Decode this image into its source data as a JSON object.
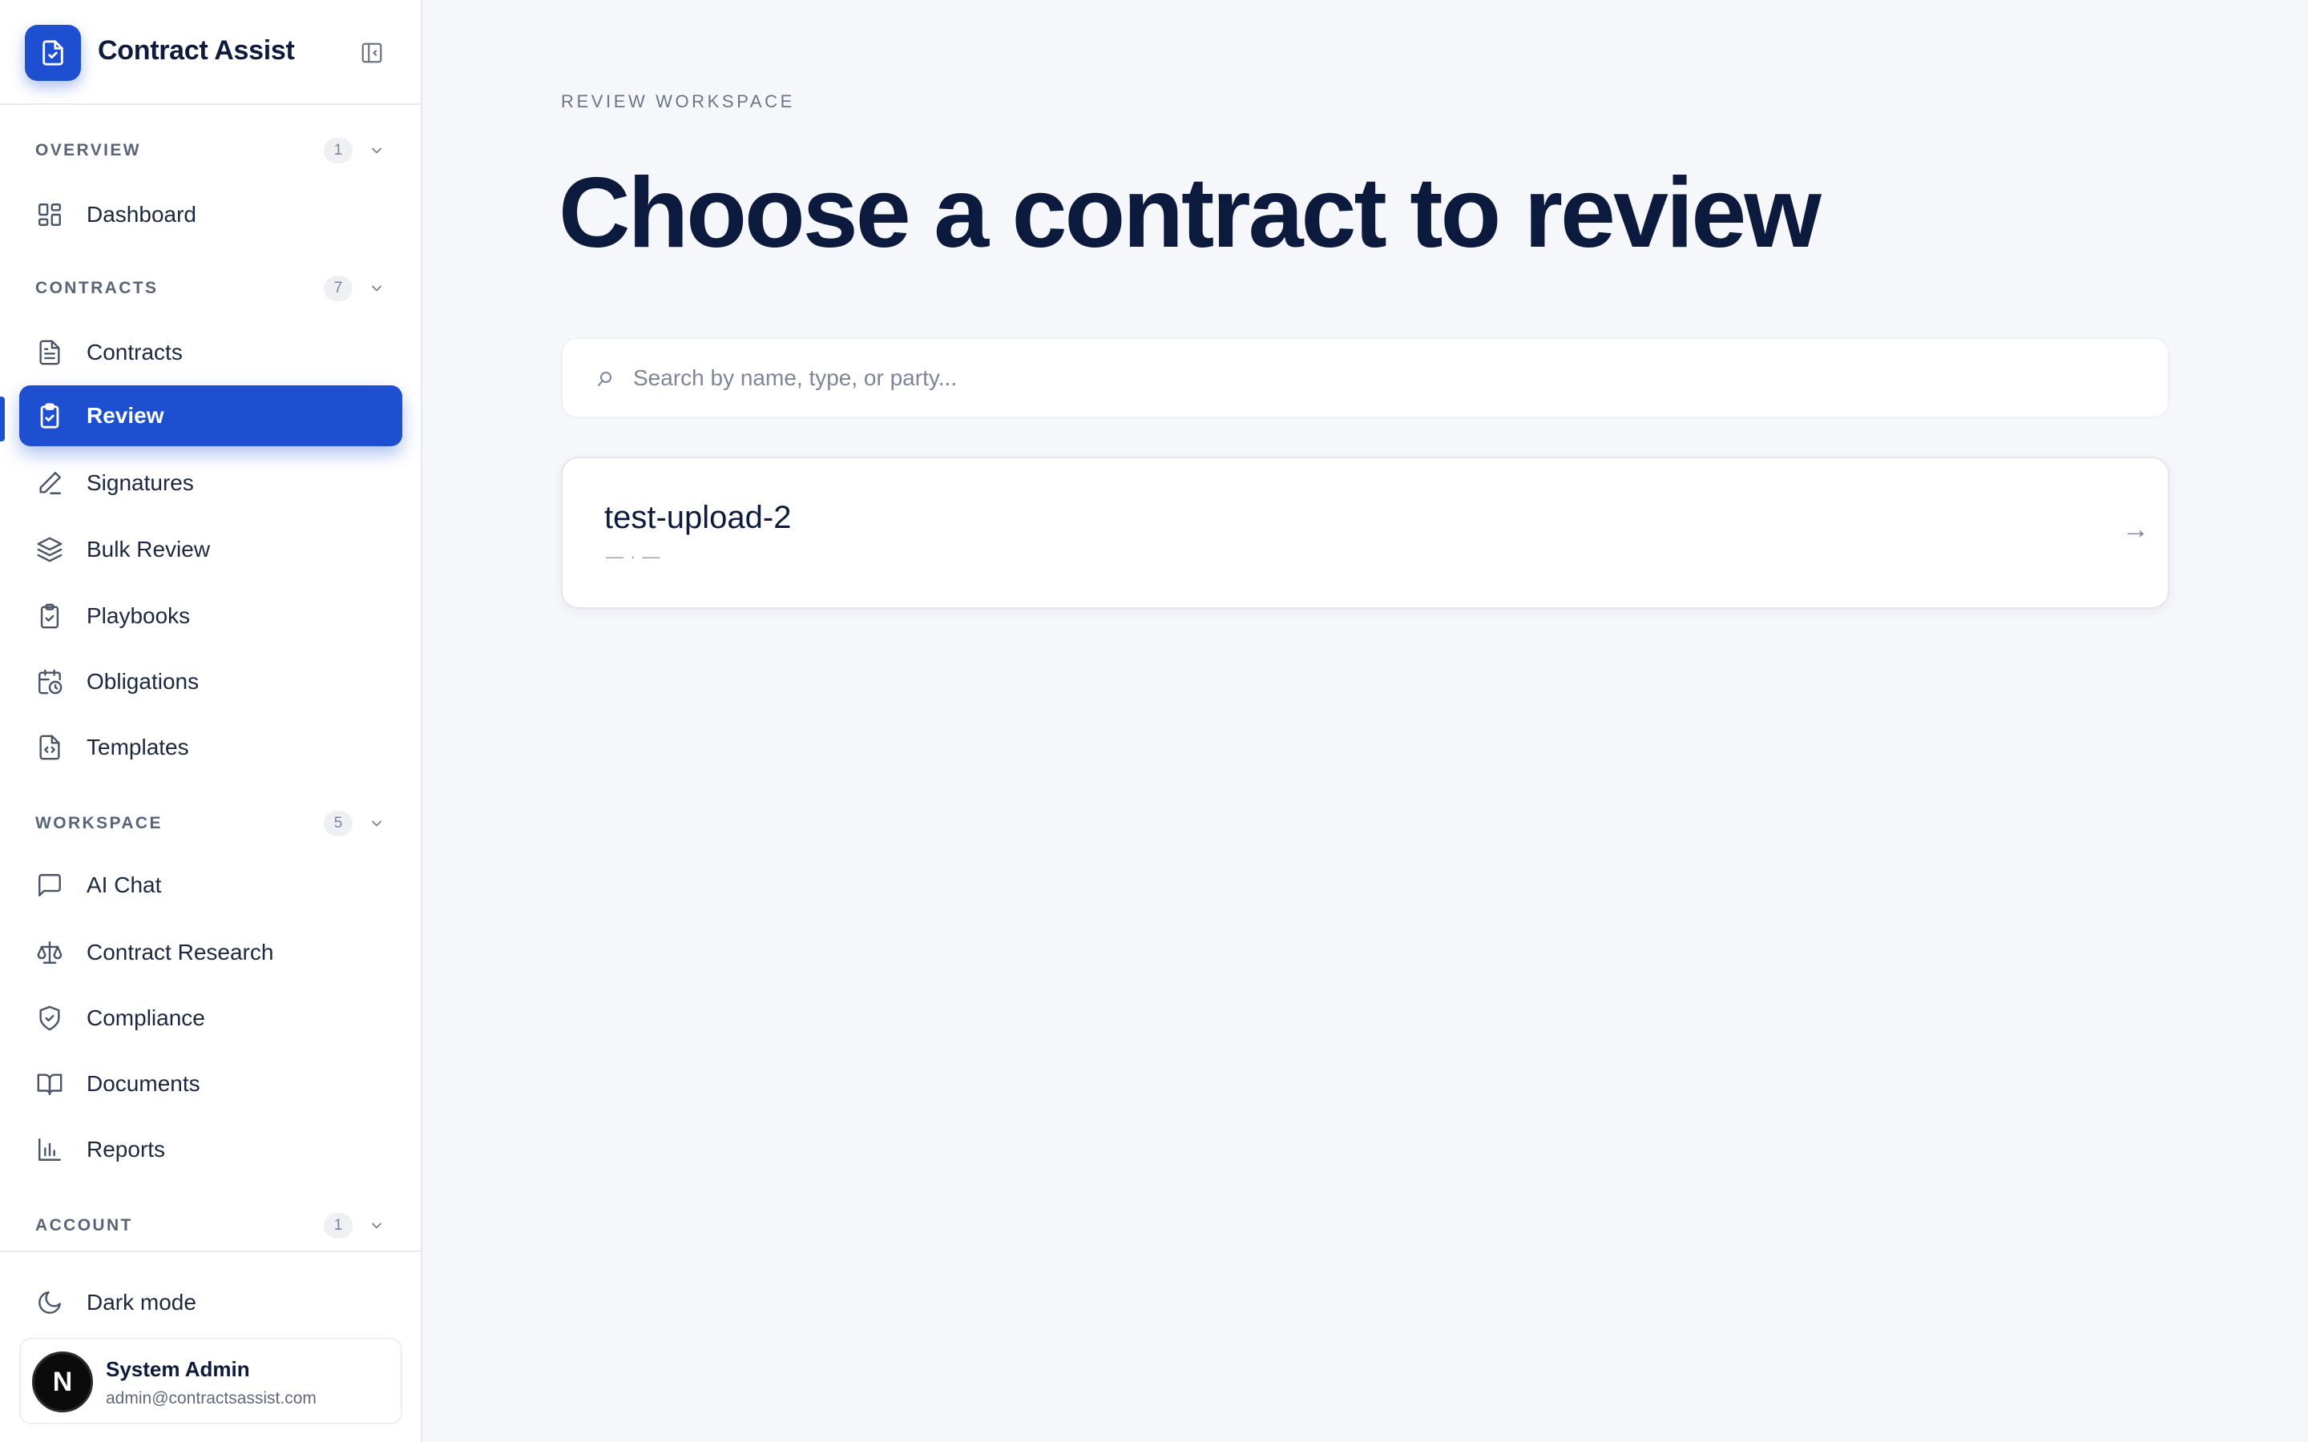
{
  "brand": {
    "title": "Contract Assist"
  },
  "sections": {
    "overview": {
      "label": "OVERVIEW",
      "count": "1"
    },
    "contracts": {
      "label": "CONTRACTS",
      "count": "7"
    },
    "workspace": {
      "label": "WORKSPACE",
      "count": "5"
    },
    "account": {
      "label": "ACCOUNT",
      "count": "1"
    }
  },
  "nav": {
    "dashboard": "Dashboard",
    "contracts": "Contracts",
    "review": "Review",
    "signatures": "Signatures",
    "bulk_review": "Bulk Review",
    "playbooks": "Playbooks",
    "obligations": "Obligations",
    "templates": "Templates",
    "ai_chat": "AI Chat",
    "contract_research": "Contract Research",
    "compliance": "Compliance",
    "documents": "Documents",
    "reports": "Reports",
    "dark_mode": "Dark mode"
  },
  "active_item": "Review",
  "user": {
    "avatar_letter": "N",
    "name": "System Admin",
    "email": "admin@contractsassist.com"
  },
  "main": {
    "eyebrow": "REVIEW WORKSPACE",
    "title": "Choose a contract to review",
    "search_placeholder": "Search by name, type, or party...",
    "contracts": [
      {
        "name": "test-upload-2",
        "meta": "— · —",
        "arrow": "→"
      }
    ]
  },
  "colors": {
    "accent": "#1f4fd1",
    "background": "#f6f7fb",
    "title_text": "#0c1a3e"
  }
}
